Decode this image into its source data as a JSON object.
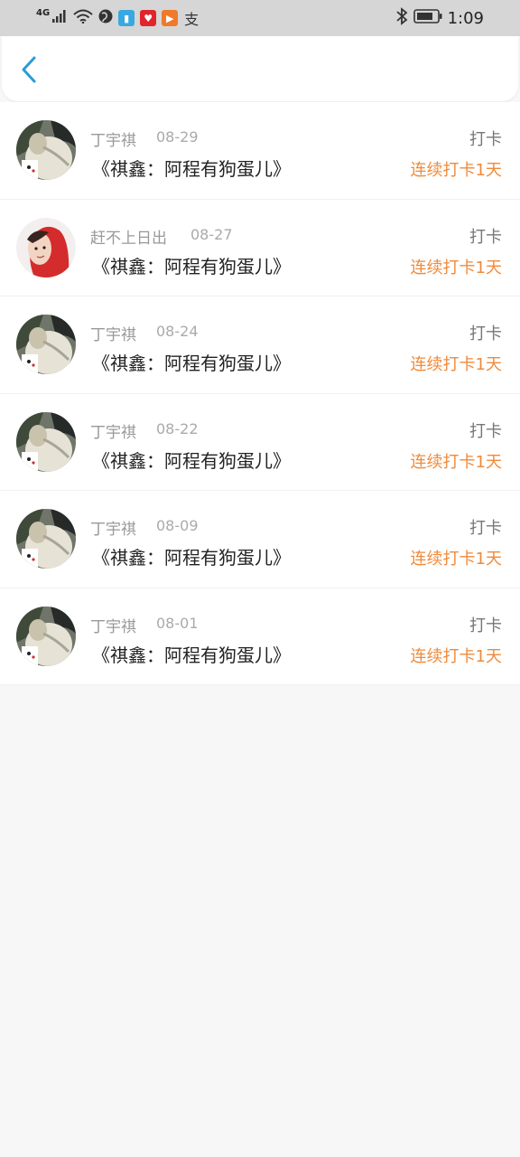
{
  "status_bar": {
    "network": "4G",
    "time": "1:09",
    "app_icons": [
      "book-app-icon",
      "gift-app-icon",
      "video-app-icon",
      "alipay-icon"
    ]
  },
  "header": {
    "back_icon": "chevron-left-icon",
    "accent_color": "#2a9bd8"
  },
  "checkins": [
    {
      "user": "丁宇祺",
      "date": "08-29",
      "title": "《祺鑫：阿程有狗蛋儿》",
      "type": "打卡",
      "streak": "连续打卡1天",
      "avatar": "plush-photo"
    },
    {
      "user": "赶不上日出",
      "date": "08-27",
      "title": "《祺鑫：阿程有狗蛋儿》",
      "type": "打卡",
      "streak": "连续打卡1天",
      "avatar": "red-hoodie-photo"
    },
    {
      "user": "丁宇祺",
      "date": "08-24",
      "title": "《祺鑫：阿程有狗蛋儿》",
      "type": "打卡",
      "streak": "连续打卡1天",
      "avatar": "plush-photo"
    },
    {
      "user": "丁宇祺",
      "date": "08-22",
      "title": "《祺鑫：阿程有狗蛋儿》",
      "type": "打卡",
      "streak": "连续打卡1天",
      "avatar": "plush-photo"
    },
    {
      "user": "丁宇祺",
      "date": "08-09",
      "title": "《祺鑫：阿程有狗蛋儿》",
      "type": "打卡",
      "streak": "连续打卡1天",
      "avatar": "plush-photo"
    },
    {
      "user": "丁宇祺",
      "date": "08-01",
      "title": "《祺鑫：阿程有狗蛋儿》",
      "type": "打卡",
      "streak": "连续打卡1天",
      "avatar": "plush-photo"
    }
  ],
  "colors": {
    "streak": "#f08a3a",
    "background": "#f8f7f7"
  }
}
